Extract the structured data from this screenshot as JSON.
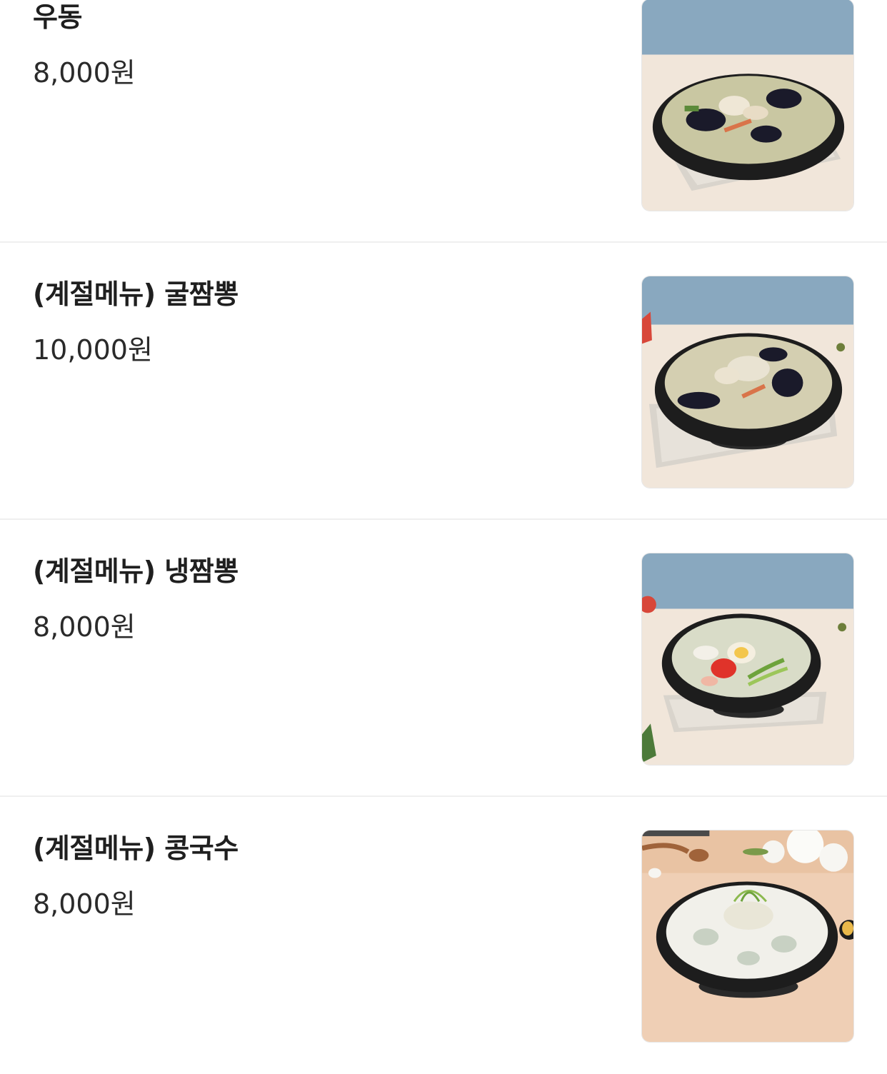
{
  "menu": {
    "items": [
      {
        "name": "우동",
        "price": "8,000원",
        "photo": {
          "type": "udon-mussel-bowl",
          "wall": "#89a8bf",
          "table": "#f1e6da",
          "broth": "#c9c7a2"
        }
      },
      {
        "name": "(계절메뉴) 굴짬뽕",
        "price": "10,000원",
        "photo": {
          "type": "oyster-jjamppong-bowl",
          "wall": "#89a8bf",
          "table": "#f1e6da",
          "broth": "#d4cfb1"
        }
      },
      {
        "name": "(계절메뉴) 냉짬뽕",
        "price": "8,000원",
        "photo": {
          "type": "cold-jjamppong-bowl",
          "wall": "#89a8bf",
          "table": "#f1e6da",
          "broth": "#d9dcc8"
        }
      },
      {
        "name": "(계절메뉴) 콩국수",
        "price": "8,000원",
        "photo": {
          "type": "kongguksu-bowl",
          "wall": "#e9c3a3",
          "table": "#efcfb5",
          "broth": "#f1f0ea"
        }
      }
    ]
  }
}
